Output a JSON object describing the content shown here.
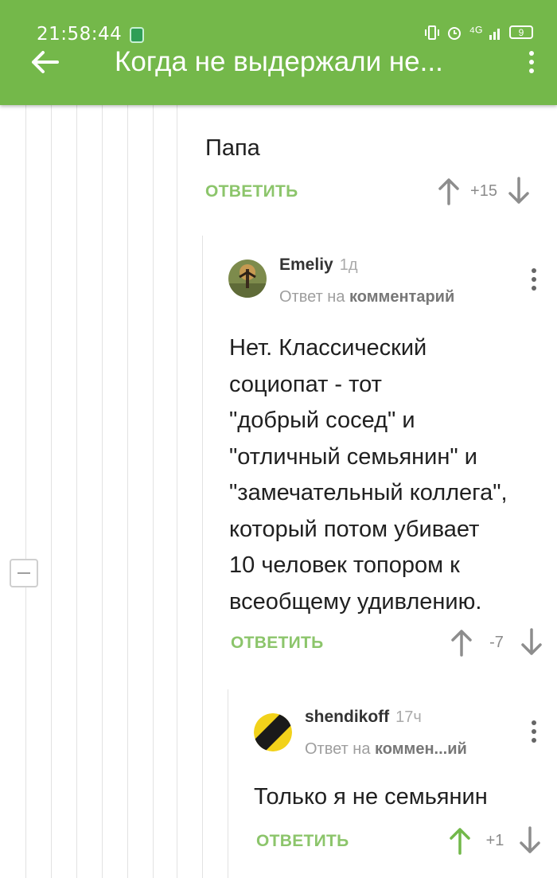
{
  "status_bar": {
    "time": "21:58:44",
    "signal": "⁴ᴳ",
    "battery": "9"
  },
  "app_bar": {
    "title": "Когда не выдержали не..."
  },
  "comments": [
    {
      "text": "Папа",
      "reply_label": "ОТВЕТИТЬ",
      "score": "+15"
    },
    {
      "author": "Emeliy",
      "age": "1д",
      "reply_to_prefix": "Ответ на",
      "reply_to_target": "комментарий",
      "text_lines": [
        "Нет. Классический",
        "социопат - тот",
        "\"добрый сосед\" и",
        "\"отличный семьянин\" и",
        "\"замечательный коллега\",",
        "который потом убивает",
        "10 человек топором к",
        "всеобщему удивлению."
      ],
      "reply_label": "ОТВЕТИТЬ",
      "score": "-7"
    },
    {
      "author": "shendikoff",
      "age": "17ч",
      "reply_to_prefix": "Ответ на",
      "reply_to_target": "коммен...ий",
      "text": "Только я не семьянин",
      "reply_label": "ОТВЕТИТЬ",
      "score": "+1"
    }
  ],
  "colors": {
    "accent": "#74b84a",
    "reply": "#8cc56b",
    "upvoted": "#72b84a"
  }
}
